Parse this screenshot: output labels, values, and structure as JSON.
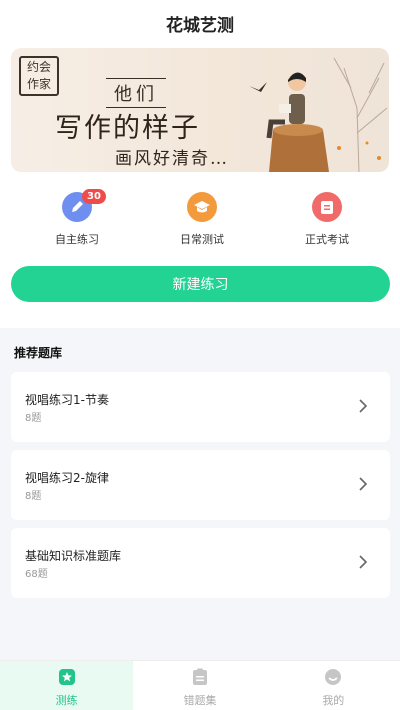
{
  "header": {
    "title": "花城艺测"
  },
  "banner": {
    "stamp_text": "约会作家",
    "tag": "他们",
    "headline": "写作的样子",
    "subline": "画风好清奇…"
  },
  "quick_actions": [
    {
      "label": "自主练习",
      "badge": "30",
      "icon": "pencil-icon",
      "color": "#6f8ff0"
    },
    {
      "label": "日常测试",
      "icon": "graduation-cap-icon",
      "color": "#f39a3d"
    },
    {
      "label": "正式考试",
      "icon": "clipboard-icon",
      "color": "#f06a6a"
    }
  ],
  "new_practice_button": {
    "label": "新建练习",
    "color": "#22d394"
  },
  "recommended": {
    "title": "推荐题库",
    "items": [
      {
        "title": "视唱练习1-节奏",
        "count": "8题"
      },
      {
        "title": "视唱练习2-旋律",
        "count": "8题"
      },
      {
        "title": "基础知识标准题库",
        "count": "68题"
      }
    ]
  },
  "tabbar": {
    "tabs": [
      {
        "label": "测练",
        "icon": "star-icon",
        "active": true
      },
      {
        "label": "错题集",
        "icon": "notebook-icon",
        "active": false
      },
      {
        "label": "我的",
        "icon": "profile-icon",
        "active": false
      }
    ],
    "active_color": "#22c38c"
  }
}
